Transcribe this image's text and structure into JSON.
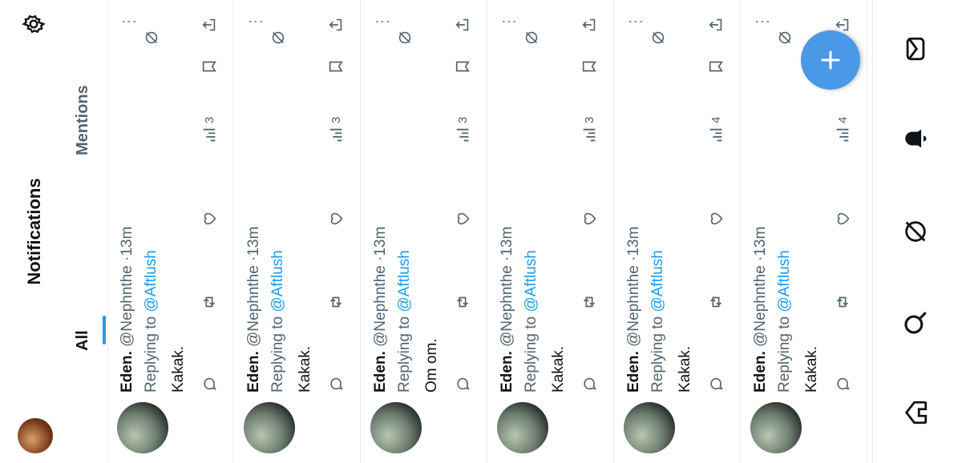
{
  "header": {
    "title": "Notifications"
  },
  "tabs": [
    {
      "label": "All"
    },
    {
      "label": "Mentions"
    }
  ],
  "tweets": [
    {
      "name": "Eden.",
      "handle": "@Nephnthe",
      "time": "13m",
      "replying_prefix": "Replying to",
      "replying_to": "@Aftlush",
      "text": "Kakak.",
      "views": "3"
    },
    {
      "name": "Eden.",
      "handle": "@Nephnthe",
      "time": "13m",
      "replying_prefix": "Replying to",
      "replying_to": "@Aftlush",
      "text": "Kakak.",
      "views": "3"
    },
    {
      "name": "Eden.",
      "handle": "@Nephnthe",
      "time": "13m",
      "replying_prefix": "Replying to",
      "replying_to": "@Aftlush",
      "text": "Om om.",
      "views": "3"
    },
    {
      "name": "Eden.",
      "handle": "@Nephnthe",
      "time": "13m",
      "replying_prefix": "Replying to",
      "replying_to": "@Aftlush",
      "text": "Kakak.",
      "views": "3"
    },
    {
      "name": "Eden.",
      "handle": "@Nephnthe",
      "time": "13m",
      "replying_prefix": "Replying to",
      "replying_to": "@Aftlush",
      "text": "Kakak.",
      "views": "4"
    },
    {
      "name": "Eden.",
      "handle": "@Nephnthe",
      "time": "13m",
      "replying_prefix": "Replying to",
      "replying_to": "@Aftlush",
      "text": "Kakak.",
      "views": "4"
    }
  ],
  "icons": {
    "settings": "gear-icon",
    "compose": "plus-icon",
    "nav": [
      "home-icon",
      "search-icon",
      "grok-icon",
      "notifications-bell-icon",
      "messages-icon"
    ]
  },
  "colors": {
    "accent": "#1d9bf0",
    "fab": "#4a99e9",
    "muted": "#536471"
  }
}
